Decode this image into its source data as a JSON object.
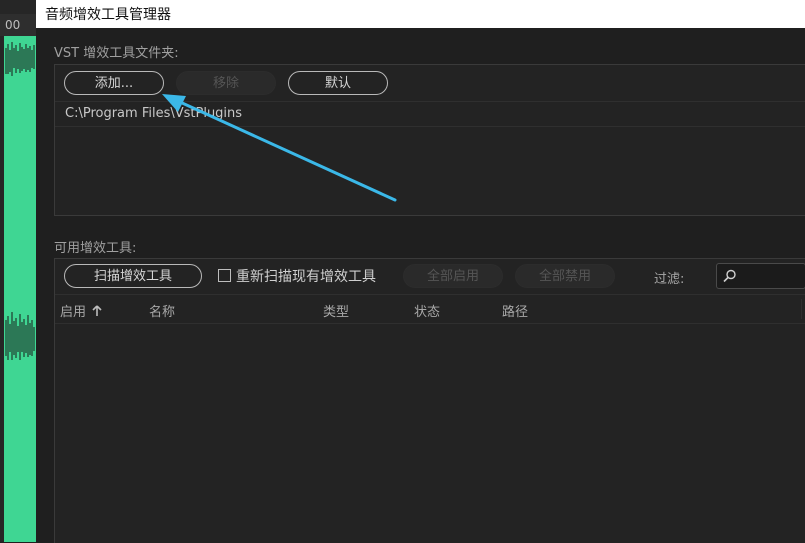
{
  "background": {
    "timeline_label": "00",
    "waveform_color": "#3fd693"
  },
  "dialog": {
    "title": "音频增效工具管理器"
  },
  "vst_folders": {
    "section_label": "VST 增效工具文件夹:",
    "add_button": "添加...",
    "remove_button": "移除",
    "default_button": "默认",
    "folders": [
      "C:\\Program Files\\VstPlugins"
    ]
  },
  "plugins": {
    "section_label": "可用增效工具:",
    "scan_button": "扫描增效工具",
    "rescan_checkbox_label": "重新扫描现有增效工具",
    "rescan_checked": false,
    "enable_all_button": "全部启用",
    "disable_all_button": "全部禁用",
    "filter_label": "过滤:",
    "filter_value": "",
    "columns": [
      "启用",
      "名称",
      "类型",
      "状态",
      "路径"
    ],
    "sort_column": "启用",
    "sort_direction": "ascending",
    "rows": []
  },
  "annotation": {
    "arrow_color": "#3bb8e8",
    "points_to": "添加..."
  }
}
